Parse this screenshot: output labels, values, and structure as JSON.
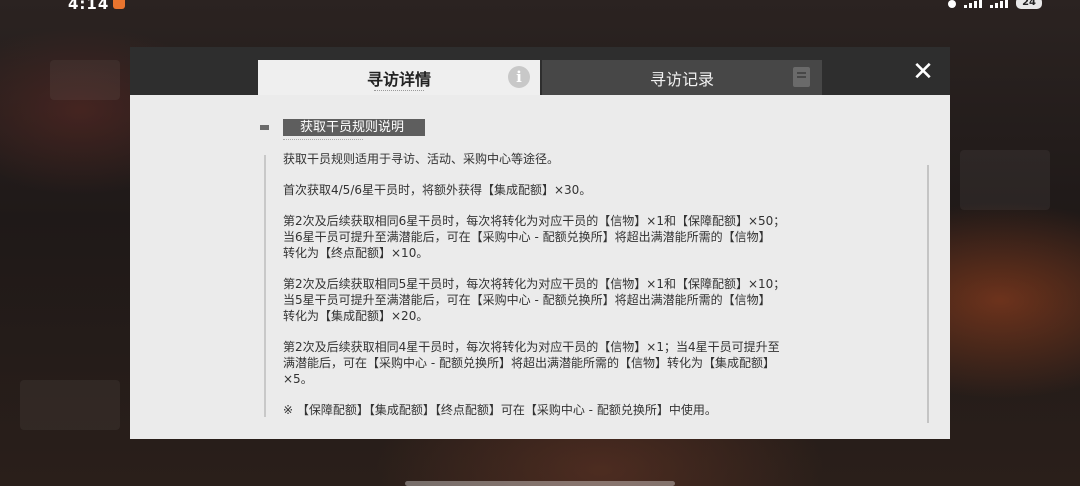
{
  "status_bar": {
    "time": "4:14",
    "dots": "···",
    "battery": "24"
  },
  "dialog": {
    "tabs": [
      {
        "label": "寻访详情",
        "active": true
      },
      {
        "label": "寻访记录",
        "active": false
      }
    ],
    "info_icon_glyph": "i",
    "close_glyph": "✕",
    "section_title": "获取干员规则说明",
    "paragraphs": [
      "获取干员规则适用于寻访、活动、采购中心等途径。",
      "首次获取4/5/6星干员时，将额外获得【集成配额】×30。",
      "第2次及后续获取相同6星干员时，每次将转化为对应干员的【信物】×1和【保障配额】×50；\n当6星干员可提升至满潜能后，可在【采购中心 - 配额兑换所】将超出满潜能所需的【信物】\n转化为【终点配额】×10。",
      "第2次及后续获取相同5星干员时，每次将转化为对应干员的【信物】×1和【保障配额】×10；\n当5星干员可提升至满潜能后，可在【采购中心 - 配额兑换所】将超出满潜能所需的【信物】\n转化为【集成配额】×20。",
      "第2次及后续获取相同4星干员时，每次将转化为对应干员的【信物】×1；当4星干员可提升至\n满潜能后，可在【采购中心 - 配额兑换所】将超出满潜能所需的【信物】转化为【集成配额】\n×5。",
      "※ 【保障配额】【集成配额】【终点配额】可在【采购中心 - 配额兑换所】中使用。"
    ]
  },
  "colors": {
    "header_bg": "#2e2e2e",
    "active_tab_bg": "#efefef",
    "inactive_tab_bg": "#474747",
    "body_bg": "#ebebeb",
    "section_title_bg": "#5e5e5e"
  }
}
